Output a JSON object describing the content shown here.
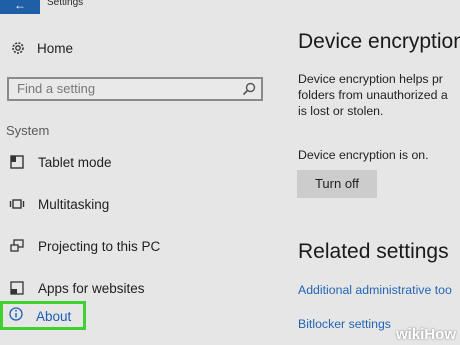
{
  "window": {
    "title": "Settings",
    "back_icon": "back-arrow-icon"
  },
  "sidebar": {
    "home_label": "Home",
    "search_placeholder": "Find a setting",
    "section_label": "System",
    "items": [
      {
        "label": "Tablet mode",
        "icon": "tablet-mode-icon"
      },
      {
        "label": "Multitasking",
        "icon": "multitasking-icon"
      },
      {
        "label": "Projecting to this PC",
        "icon": "projecting-icon"
      },
      {
        "label": "Apps for websites",
        "icon": "apps-for-websites-icon"
      },
      {
        "label": "About",
        "icon": "info-icon",
        "selected": true
      }
    ]
  },
  "main": {
    "title": "Device encryption",
    "description_lines": [
      "Device encryption helps pr",
      "folders from unauthorized a",
      "is lost or stolen."
    ],
    "status": "Device encryption is on.",
    "turn_off_label": "Turn off",
    "related_title": "Related settings",
    "related_links": [
      "Additional administrative too",
      "Bitlocker settings"
    ]
  },
  "watermark": "wikiHow",
  "colors": {
    "accent": "#1f5fa8",
    "highlight": "#3fd12f",
    "link": "#2366b5",
    "background": "#e6e6e6"
  }
}
